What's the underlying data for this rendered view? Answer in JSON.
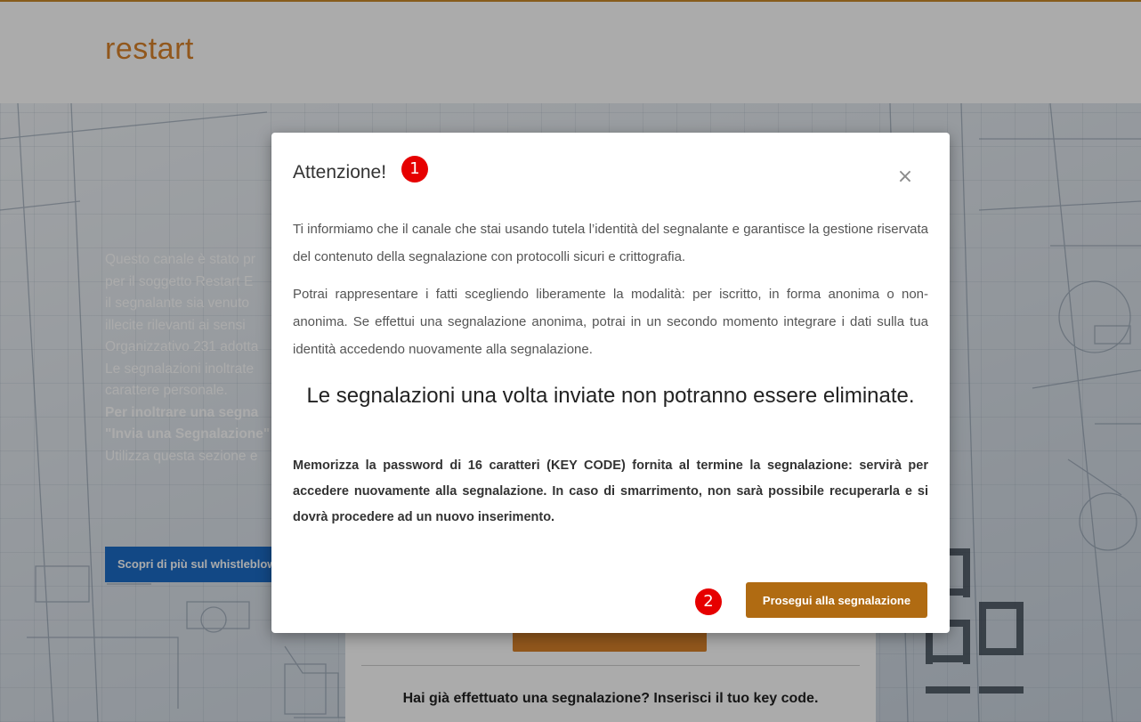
{
  "header": {
    "logo_text": "restart"
  },
  "hero": {
    "lines": [
      "Questo canale è stato pr",
      "per il soggetto Restart E",
      "il segnalante sia venuto",
      "illecite rilevanti ai sensi",
      "Organizzativo 231 adotta",
      "Le segnalazioni inoltrate",
      "carattere personale.",
      "Per inoltrare una segna",
      "\"Invia una Segnalazione\"",
      "Utilizza questa sezione e"
    ],
    "learn_more_label": "Scopri di più sul whistleblowi"
  },
  "card": {
    "keycode_prompt": "Hai già effettuato una segnalazione? Inserisci il tuo key code."
  },
  "modal": {
    "title": "Attenzione!",
    "close_symbol": "×",
    "paragraph_1": "Ti informiamo che il canale che stai usando tutela l’identità del segnalante e garantisce la gestione riservata del contenuto della segnalazione con protocolli sicuri e crittografia.",
    "paragraph_2": "Potrai rappresentare i fatti scegliendo liberamente la modalità: per iscritto, in forma anonima o non-anonima. Se effettui una segnalazione anonima, potrai in un secondo momento integrare i dati sulla tua identità accedendo nuovamente alla segnalazione.",
    "heading": "Le segnalazioni una volta inviate non potranno essere eliminate.",
    "paragraph_3": "Memorizza la password di 16 caratteri (KEY CODE) fornita al termine la segnalazione: servirà per accedere nuovamente alla segnalazione. In caso di smarrimento, non sarà possibile recuperarla e si dovrà procedere ad un nuovo inserimento.",
    "proceed_label": "Prosegui alla segnalazione"
  },
  "annotations": {
    "badge_1": "1",
    "badge_2": "2"
  },
  "colors": {
    "brand_orange": "#d9822b",
    "proceed_button": "#b06b12",
    "learn_button": "#1c6cc6",
    "badge": "#e60000"
  }
}
